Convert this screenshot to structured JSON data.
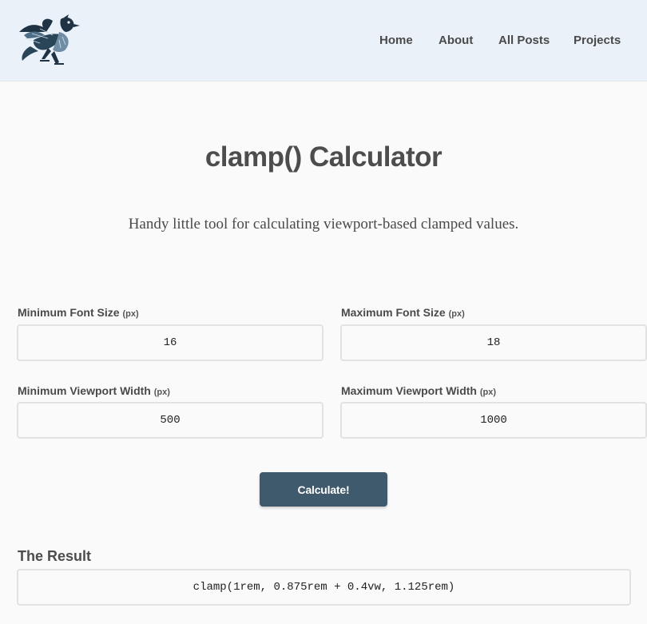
{
  "nav": {
    "items": [
      {
        "label": "Home"
      },
      {
        "label": "About"
      },
      {
        "label": "All Posts"
      },
      {
        "label": "Projects"
      }
    ]
  },
  "page": {
    "title": "clamp() Calculator",
    "subtitle": "Handy little tool for calculating viewport-based clamped values."
  },
  "form": {
    "min_font": {
      "label": "Minimum Font Size",
      "unit": "(px)",
      "value": "16"
    },
    "max_font": {
      "label": "Maximum Font Size",
      "unit": "(px)",
      "value": "18"
    },
    "min_vw": {
      "label": "Minimum Viewport Width",
      "unit": "(px)",
      "value": "500"
    },
    "max_vw": {
      "label": "Maximum Viewport Width",
      "unit": "(px)",
      "value": "1000"
    },
    "calculate_label": "Calculate!"
  },
  "result": {
    "heading": "The Result",
    "value": "clamp(1rem, 0.875rem + 0.4vw, 1.125rem)"
  },
  "colors": {
    "header_bg": "#eaf1f8",
    "page_bg": "#fafafa",
    "button_bg": "#3f5a6c",
    "text": "#4a4a4a",
    "logo_ink": "#1f3344"
  },
  "icons": {
    "logo": "bird-logo-icon"
  }
}
